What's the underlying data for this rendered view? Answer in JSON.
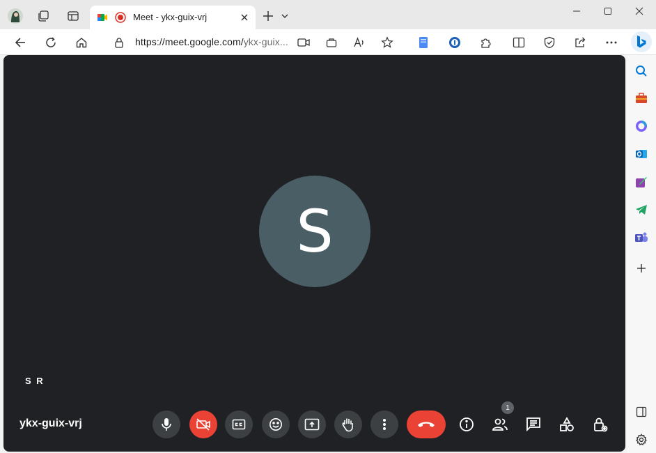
{
  "tab": {
    "title": "Meet - ykx-guix-vrj"
  },
  "address_bar": {
    "url_host": "https://meet.google.com/",
    "url_path": "ykx-guix..."
  },
  "meeting": {
    "avatar_letter": "S",
    "participant_name": "S R",
    "meeting_code": "ykx-guix-vrj",
    "people_count": "1"
  },
  "colors": {
    "meet_background": "#202124",
    "control_button": "#3c4043",
    "danger": "#ea4335",
    "avatar": "#4a5e66",
    "edge_accent": "#0078d4"
  },
  "icons": {
    "browser": [
      "profile-icon",
      "workspaces-icon",
      "tab-actions-icon",
      "meet-favicon",
      "recording-icon",
      "close-tab-icon",
      "new-tab-icon",
      "tab-list-icon",
      "minimize-icon",
      "maximize-icon",
      "window-close-icon"
    ],
    "toolbar": [
      "back-icon",
      "refresh-icon",
      "home-icon",
      "lock-icon",
      "camera-permission-icon",
      "app-available-icon",
      "read-aloud-icon",
      "favorite-icon",
      "extension-doc-icon",
      "password-manager-icon",
      "extensions-icon",
      "split-screen-icon",
      "browser-essentials-icon",
      "share-icon",
      "more-icon",
      "copilot-icon"
    ],
    "sidebar": [
      "search-icon",
      "tools-icon",
      "microsoft365-icon",
      "outlook-icon",
      "designer-icon",
      "telegram-icon",
      "teams-icon",
      "add-icon",
      "hide-sidebar-icon",
      "settings-icon"
    ],
    "meet_controls": [
      "mic-icon",
      "camera-off-icon",
      "captions-icon",
      "emoji-icon",
      "present-icon",
      "raise-hand-icon",
      "more-options-icon",
      "end-call-icon",
      "info-icon",
      "people-icon",
      "chat-icon",
      "activities-icon",
      "host-controls-icon"
    ]
  }
}
